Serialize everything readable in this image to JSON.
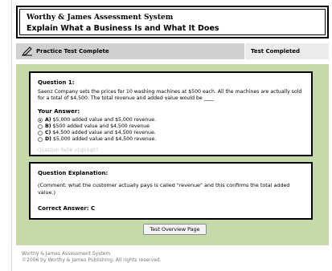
{
  "header": {
    "app_title": "Worthy & James Assessment System",
    "page_title": "Explain What a Business Is and What It Does"
  },
  "status": {
    "left_label": "Practice Test Complete",
    "right_label": "Test Completed",
    "icon": "pencil-icon"
  },
  "question": {
    "label": "Question 1:",
    "text": "Saenz Company sets the prices for 10 washing machines at $500 each. All the machines are actually sold for a total of $4,500. The total revenue and added value would be ____",
    "your_answer_label": "Your Answer:",
    "answers": [
      {
        "letter": "A)",
        "text": "$5,000 added value and $5,000 revenue.",
        "selected": true
      },
      {
        "letter": "B)",
        "text": "$500 added value and $4,500 revenue",
        "selected": false
      },
      {
        "letter": "C)",
        "text": "$4,500 added value and $4,500 revenue.",
        "selected": false
      },
      {
        "letter": "D)",
        "text": "$5,000 added value and $4,500 revenue.",
        "selected": false
      }
    ],
    "ref": "Question Ref# v1g01q07"
  },
  "explanation": {
    "label": "Question Explanation:",
    "text": "(Comment: what the customer actually pays is called \"revenue\" and this confirms the total added value.)",
    "correct_answer": "Correct Answer: C"
  },
  "buttons": {
    "overview": "Test Overview Page"
  },
  "footer": {
    "line1": "Worthy & James Assessment System",
    "line2": "©2006 by Worthy & James Publishing. All rights reserved."
  },
  "colors": {
    "panel": "#c6d9a8",
    "status_left": "#d0d0d0",
    "status_right": "#ececec"
  }
}
